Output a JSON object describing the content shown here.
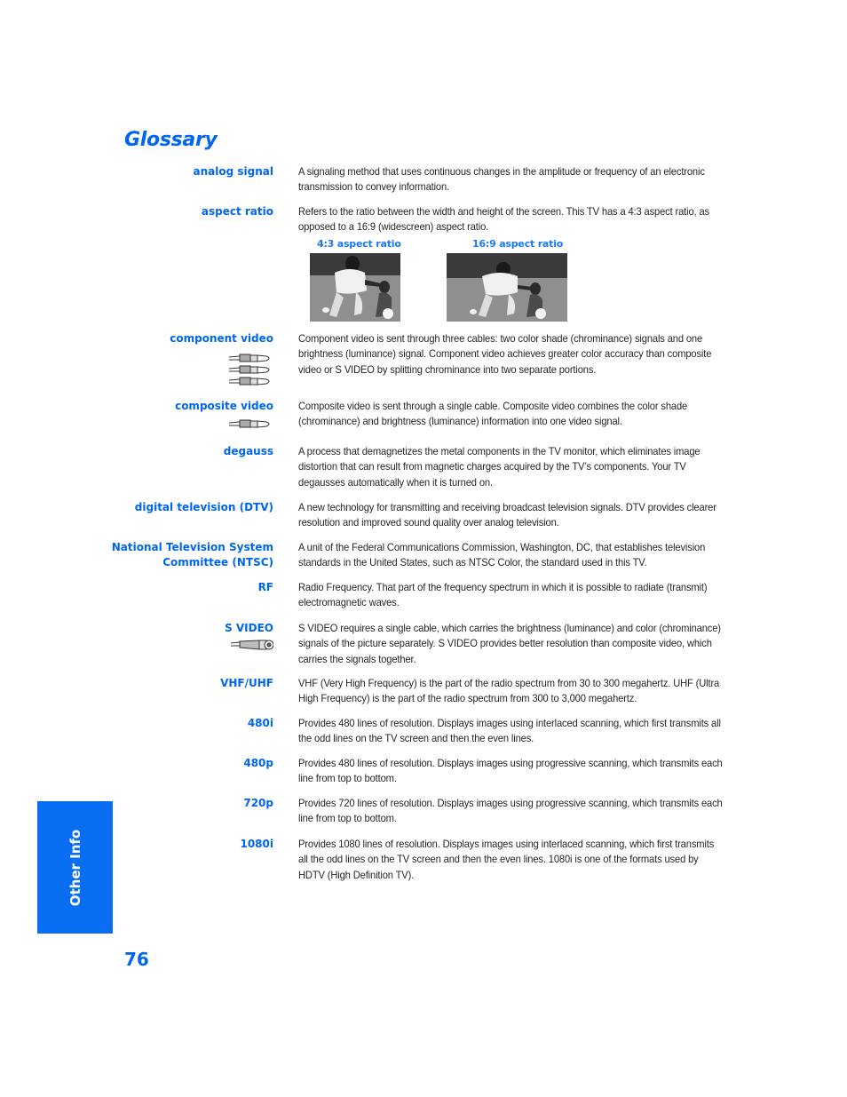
{
  "page": {
    "title": "Glossary",
    "page_number": "76",
    "side_tab_label": "Other Info",
    "accent_color": "#0066ee"
  },
  "entries": [
    {
      "term": [
        "analog signal"
      ],
      "definition": "A signaling method that uses continuous changes in the amplitude or frequency of an electronic transmission to convey information."
    },
    {
      "term": [
        "aspect ratio"
      ],
      "definition": "Refers to the ratio between the width and height of the screen. This TV has a 4:3 aspect ratio, as opposed to a 16:9 (widescreen) aspect ratio.",
      "figures": [
        {
          "caption": "4:3 aspect ratio",
          "image": "football-player-with-child-photo-4x3"
        },
        {
          "caption": "16:9 aspect ratio",
          "image": "football-player-with-child-photo-16x9"
        }
      ]
    },
    {
      "term": [
        "component video"
      ],
      "icon": "three-rca-cables-icon",
      "definition": "Component video is sent through three cables: two color shade (chrominance) signals and one brightness (luminance) signal. Component video achieves greater color accuracy than composite video or S VIDEO by splitting chrominance into two separate portions."
    },
    {
      "term": [
        "composite video"
      ],
      "icon": "rca-cable-icon",
      "definition": "Composite video is sent through a single cable. Composite video combines the color shade (chrominance) and brightness (luminance) information into one video signal."
    },
    {
      "term": [
        "degauss"
      ],
      "definition": "A process that demagnetizes the metal components in the TV monitor, which eliminates image distortion that can result from magnetic charges acquired by the TV’s components. Your TV degausses automatically when it is turned on."
    },
    {
      "term": [
        "digital television (DTV)"
      ],
      "definition": "A new technology for transmitting and receiving broadcast television signals. DTV provides clearer resolution and improved sound quality over analog television."
    },
    {
      "term": [
        "National Television System",
        "Committee (NTSC)"
      ],
      "definition": "A unit of the Federal Communications Commission, Washington, DC, that establishes television standards in the United States, such as NTSC Color, the standard used in this TV."
    },
    {
      "term": [
        "RF"
      ],
      "definition": "Radio Frequency. That part of the frequency spectrum in which it is possible to radiate (transmit) electromagnetic waves."
    },
    {
      "term": [
        "S VIDEO"
      ],
      "icon": "s-video-cable-icon",
      "definition": "S VIDEO requires a single cable, which carries the brightness (luminance) and color (chrominance) signals of the picture separately. S VIDEO provides better resolution than composite video, which carries the signals together."
    },
    {
      "term": [
        "VHF/UHF"
      ],
      "definition": "VHF (Very High Frequency) is the part of the radio spectrum from 30 to 300 megahertz. UHF (Ultra High Frequency) is the part of the radio spectrum from 300 to 3,000 megahertz."
    },
    {
      "term": [
        "480i"
      ],
      "definition": "Provides 480 lines of resolution. Displays images using interlaced scanning, which first transmits all the odd lines on the TV screen and then the even lines."
    },
    {
      "term": [
        "480p"
      ],
      "definition": "Provides 480 lines of resolution. Displays images using progressive scanning, which transmits each line from top to bottom."
    },
    {
      "term": [
        "720p"
      ],
      "definition": "Provides 720 lines of resolution. Displays images using progressive scanning, which transmits each line from top to bottom."
    },
    {
      "term": [
        "1080i"
      ],
      "definition": "Provides 1080 lines of resolution. Displays images using interlaced scanning, which first transmits all the odd lines on the TV screen and then the even lines. 1080i is one of the formats used by HDTV (High Definition TV)."
    }
  ]
}
